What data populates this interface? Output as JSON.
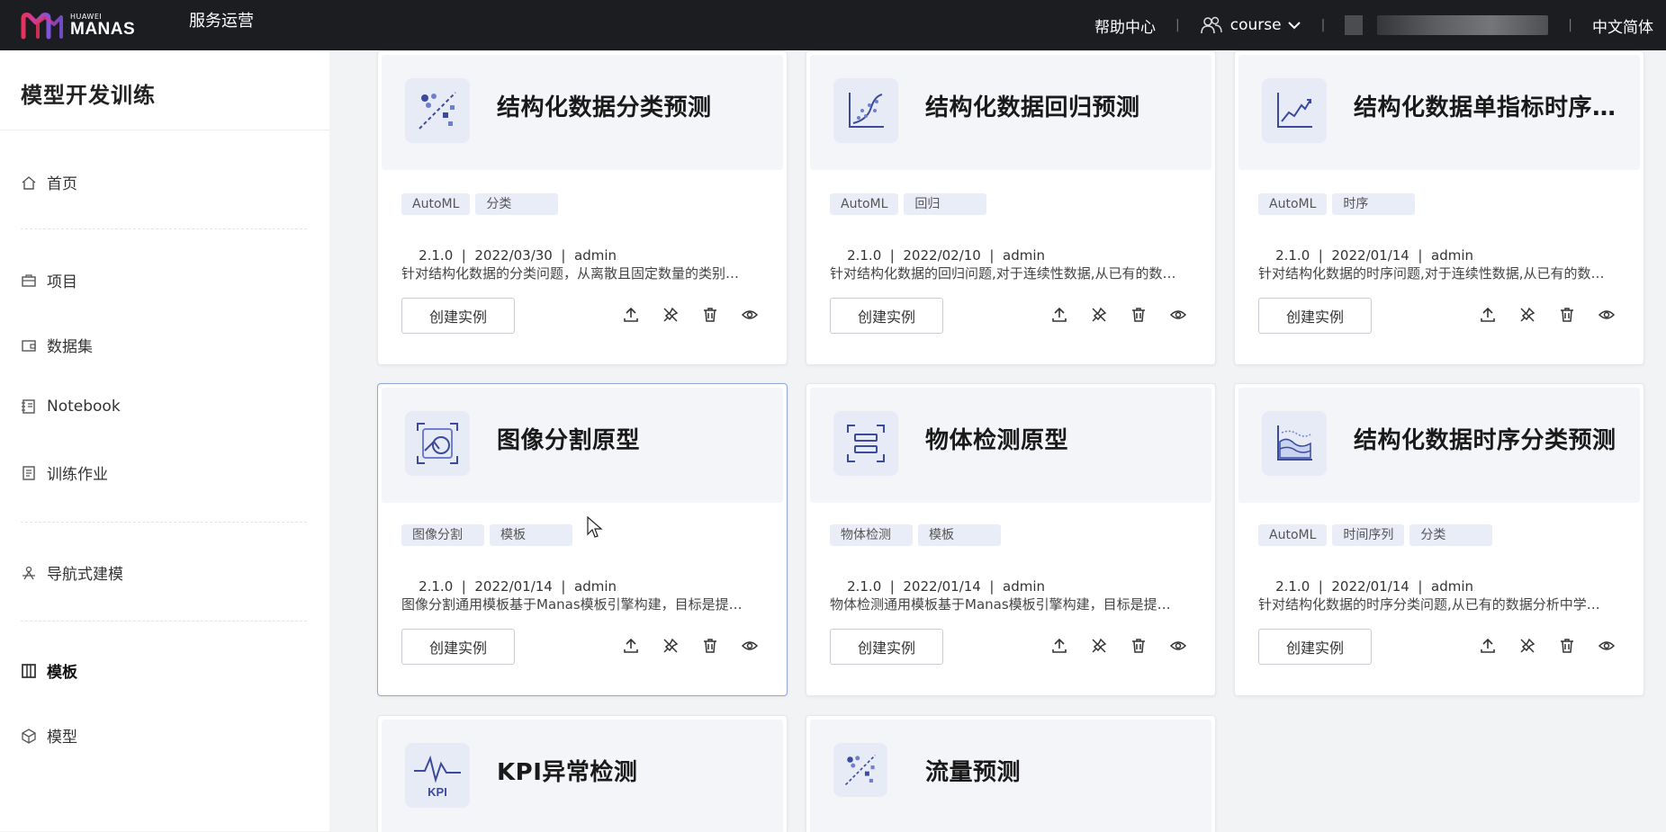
{
  "topbar": {
    "logo_small": "HUAWEI",
    "logo_big": "MANAS",
    "nav": "服务运营",
    "help": "帮助中心",
    "user": "course",
    "language": "中文简体"
  },
  "sidebar": {
    "title": "模型开发训练",
    "items": [
      {
        "label": "首页",
        "icon": "home-icon"
      },
      {
        "label": "项目",
        "icon": "briefcase-icon"
      },
      {
        "label": "数据集",
        "icon": "wallet-icon"
      },
      {
        "label": "Notebook",
        "icon": "notebook-icon"
      },
      {
        "label": "训练作业",
        "icon": "document-icon"
      },
      {
        "label": "导航式建模",
        "icon": "navigation-icon"
      },
      {
        "label": "模板",
        "icon": "template-icon",
        "active": true
      },
      {
        "label": "模型",
        "icon": "cube-icon"
      }
    ]
  },
  "cards": [
    {
      "title": "结构化数据分类预测",
      "icon": "scatter-classify-icon",
      "tags": [
        "AutoML",
        "分类"
      ],
      "version": "2.1.0",
      "date": "2022/03/30",
      "author": "admin",
      "description": "针对结构化数据的分类问题，从离散且固定数量的类别中预测…",
      "button": "创建实例"
    },
    {
      "title": "结构化数据回归预测",
      "icon": "regression-chart-icon",
      "tags": [
        "AutoML",
        "回归"
      ],
      "version": "2.1.0",
      "date": "2022/02/10",
      "author": "admin",
      "description": "针对结构化数据的回归问题,对于连续性数据,从已有的数据中…",
      "button": "创建实例"
    },
    {
      "title": "结构化数据单指标时序预测",
      "icon": "trend-line-icon",
      "tags": [
        "AutoML",
        "时序"
      ],
      "version": "2.1.0",
      "date": "2022/01/14",
      "author": "admin",
      "description": "针对结构化数据的时序问题,对于连续性数据,从已有的数据中…",
      "button": "创建实例"
    },
    {
      "title": "图像分割原型",
      "icon": "image-segmentation-icon",
      "tags": [
        "图像分割",
        "模板"
      ],
      "version": "2.1.0",
      "date": "2022/01/14",
      "author": "admin",
      "description": "图像分割通用模板基于Manas模板引擎构建，目标是提供…",
      "button": "创建实例"
    },
    {
      "title": "物体检测原型",
      "icon": "object-detection-icon",
      "tags": [
        "物体检测",
        "模板"
      ],
      "version": "2.1.0",
      "date": "2022/01/14",
      "author": "admin",
      "description": "物体检测通用模板基于Manas模板引擎构建，目标是提供…",
      "button": "创建实例"
    },
    {
      "title": "结构化数据时序分类预测",
      "icon": "area-chart-icon",
      "tags": [
        "AutoML",
        "时间序列",
        "分类"
      ],
      "version": "2.1.0",
      "date": "2022/01/14",
      "author": "admin",
      "description": "针对结构化数据的时序分类问题,从已有的数据分析中学习…",
      "button": "创建实例"
    },
    {
      "title": "KPI异常检测",
      "icon": "kpi-waveform-icon",
      "icon_text": "KPI",
      "tags": [],
      "version": "",
      "date": "",
      "author": "",
      "description": "",
      "button": ""
    },
    {
      "title": "流量预测",
      "icon": "scatter-flow-icon",
      "tags": [],
      "version": "",
      "date": "",
      "author": "",
      "description": "",
      "button": ""
    }
  ],
  "colors": {
    "topbar_bg": "#1b1d21",
    "icon_stroke": "#3b4a9c",
    "tag_bg": "#e9edf8",
    "selected_border": "#8fa6d6"
  }
}
